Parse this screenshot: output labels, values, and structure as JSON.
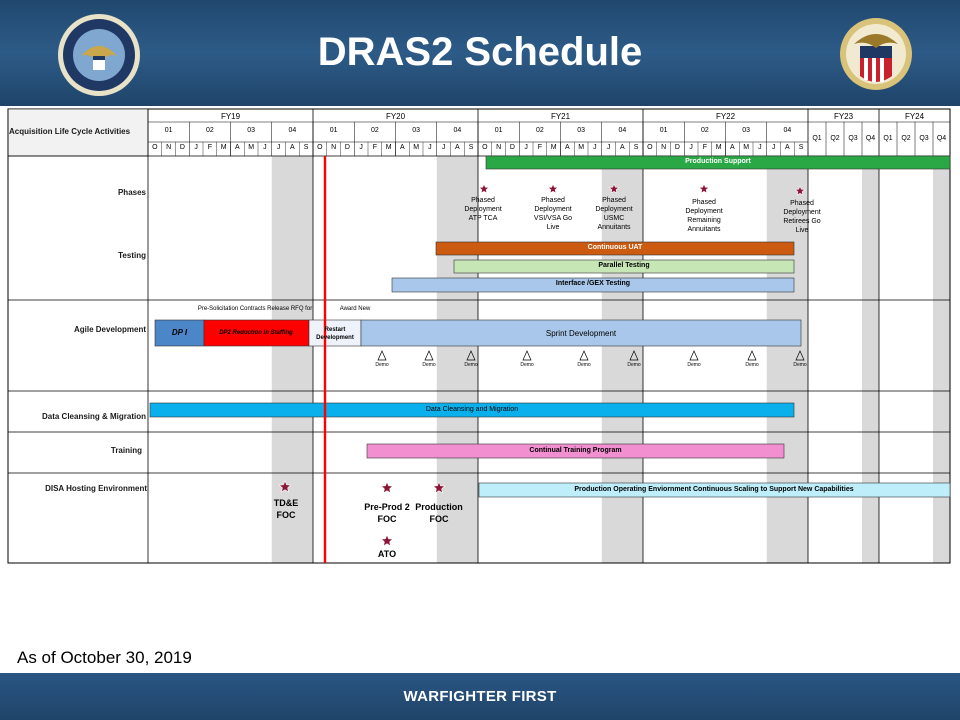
{
  "header": {
    "title": "DRAS2 Schedule"
  },
  "grid": {
    "corner_label": "Acquisition Life Cycle Activities",
    "fiscal_years": [
      "FY19",
      "FY20",
      "FY21",
      "FY22",
      "FY23",
      "FY24"
    ],
    "quarters_detailed": [
      "01",
      "02",
      "03",
      "04"
    ],
    "months": [
      "O",
      "N",
      "D",
      "J",
      "F",
      "M",
      "A",
      "M",
      "J",
      "J",
      "A",
      "S"
    ],
    "quarters_summary": [
      "Q1",
      "Q2",
      "Q3",
      "Q4"
    ]
  },
  "rows": {
    "phases": "Phases",
    "testing": "Testing",
    "agile": "Agile Development",
    "data": "Data Cleansing & Migration",
    "training": "Training",
    "disa": "DISA Hosting Environment"
  },
  "bars": {
    "production_support": "Production Support",
    "continuous_uat": "Continuous UAT",
    "parallel_testing": "Parallel Testing",
    "interface_testing": "Interface /GEX Testing",
    "dpi": "DP I",
    "dp2": "DP2 Reduction in Staffing",
    "restart": "Restart Development",
    "sprint": "Sprint Development",
    "data_cleansing": "Data Cleansing and Migration",
    "training": "Continual Training Program",
    "production_env": "Production Operating Enviornment Continuous Scaling to Support New Capabilities"
  },
  "phase_notes": [
    "Phased Deployment ATP TCA",
    "Phased Deployment VSI/VSA Go Live",
    "Phased Deployment USMC Annuitants",
    "Phased Deployment Remaining Annuitants",
    "Phased Deployment Retirees Go Live"
  ],
  "agile_notes": {
    "overlap_text": "Pre-Solicitation Contracts Release RFQ for",
    "award": "Award New"
  },
  "demo_label": "Demo",
  "milestones": {
    "tde": "TD&E FOC",
    "preprod": "Pre-Prod 2 FOC",
    "production": "Production FOC",
    "ato": "ATO"
  },
  "colors": {
    "header_bg": "#2d5b87",
    "production_support": "#2aa845",
    "continuous_uat": "#cc5a10",
    "parallel_testing": "#c6e6b6",
    "interface_testing": "#a9c7ea",
    "dpi": "#4a86c8",
    "dp2": "#ff0000",
    "sprint": "#a9c7ea",
    "data_cleansing": "#0ab0ec",
    "training": "#f28fd0",
    "production_env": "#bfeefb",
    "today_line": "#ff0000",
    "shade": "#d9d9d9",
    "star": "#8b1536"
  },
  "footer": {
    "as_of": "As of October 30, 2019",
    "tagline": "WARFIGHTER FIRST"
  }
}
